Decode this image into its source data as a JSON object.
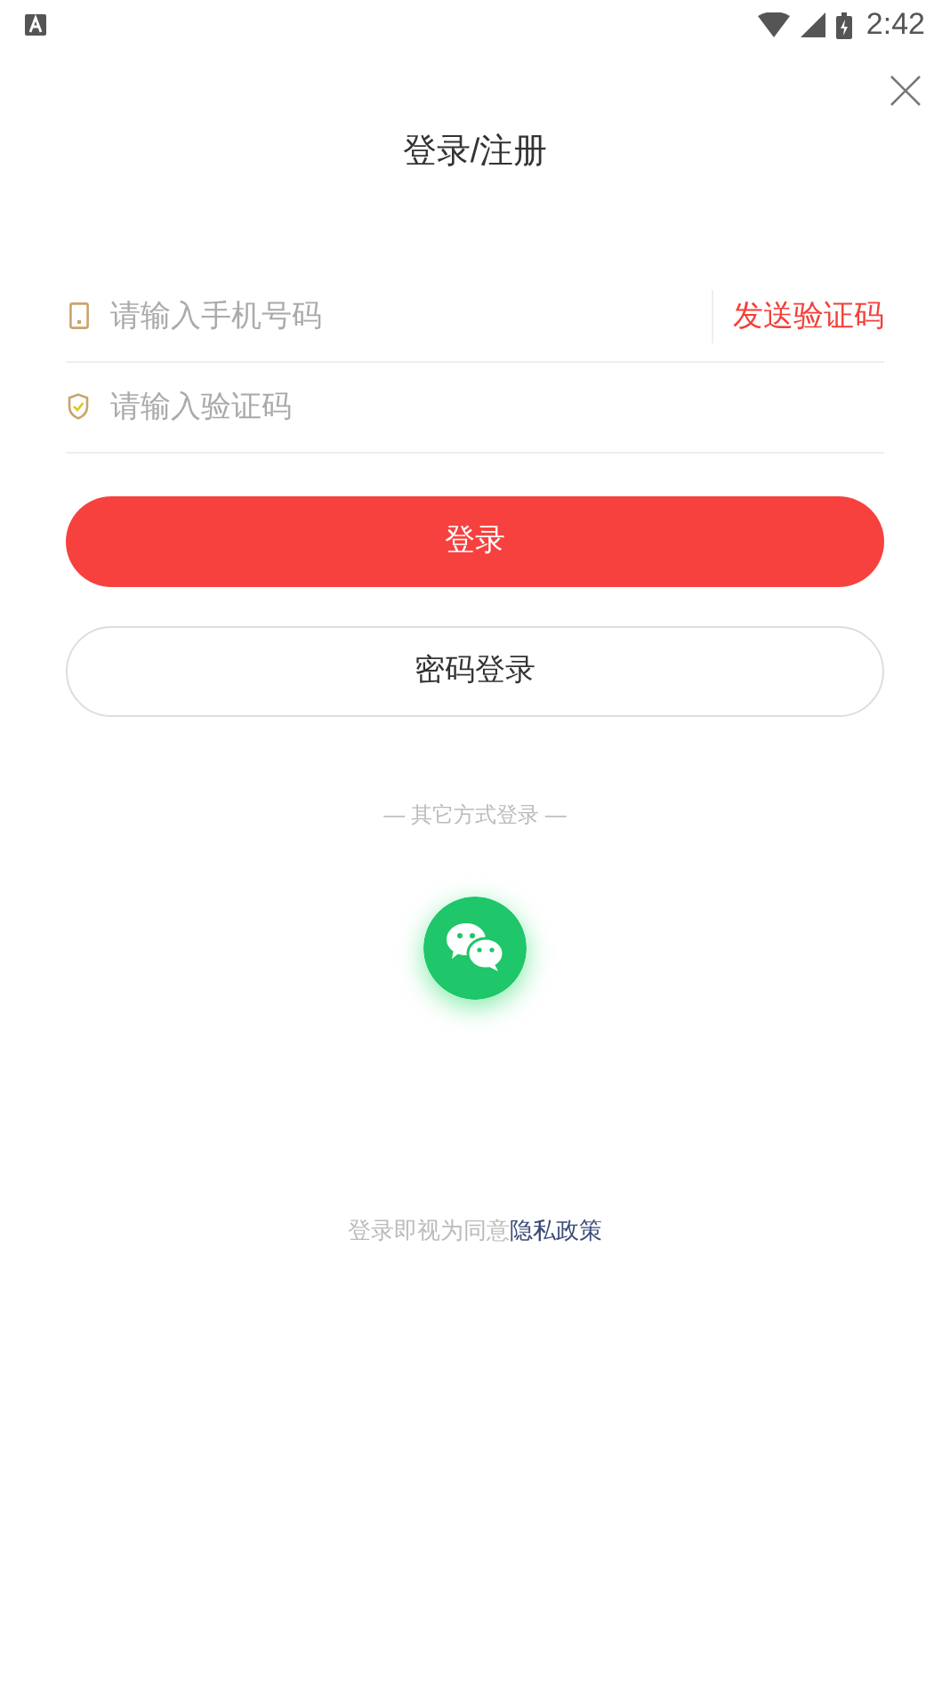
{
  "status_bar": {
    "time": "2:42"
  },
  "title": "登录/注册",
  "phone_field": {
    "placeholder": "请输入手机号码"
  },
  "send_code_button": "发送验证码",
  "code_field": {
    "placeholder": "请输入验证码"
  },
  "login_button": "登录",
  "password_login_button": "密码登录",
  "other_methods_label": "— 其它方式登录 —",
  "agreement": {
    "text": "登录即视为同意",
    "link": "隐私政策"
  }
}
